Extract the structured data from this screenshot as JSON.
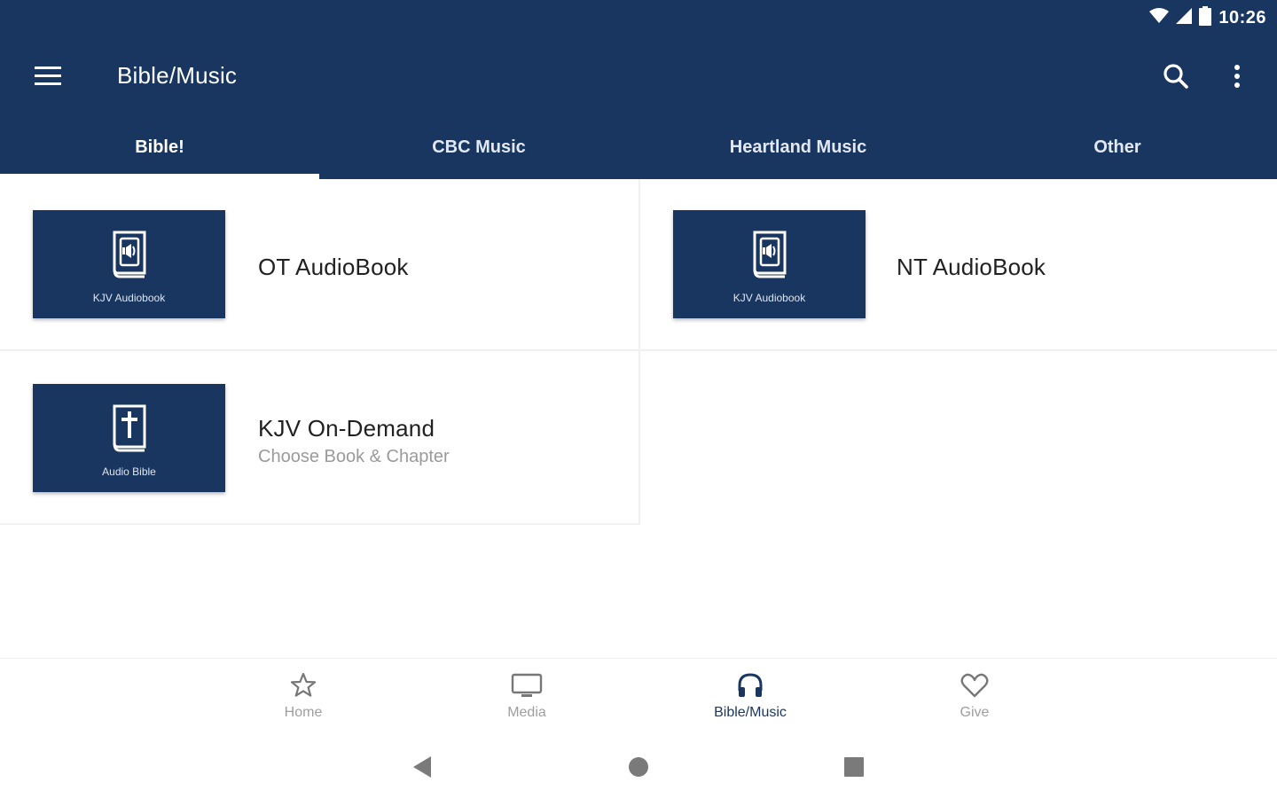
{
  "status_bar": {
    "time": "10:26"
  },
  "toolbar": {
    "title": "Bible/Music"
  },
  "tabs": [
    {
      "label": "Bible!",
      "active": true
    },
    {
      "label": "CBC Music",
      "active": false
    },
    {
      "label": "Heartland Music",
      "active": false
    },
    {
      "label": "Other",
      "active": false
    }
  ],
  "cards": [
    {
      "title": "OT AudioBook",
      "thumb_caption": "KJV Audiobook",
      "icon": "audio-book-icon"
    },
    {
      "title": "NT AudioBook",
      "thumb_caption": "KJV Audiobook",
      "icon": "audio-book-icon"
    },
    {
      "title": "KJV On-Demand",
      "subtitle": "Choose Book & Chapter",
      "thumb_caption": "Audio Bible",
      "icon": "bible-cross-icon"
    }
  ],
  "bottom_nav": [
    {
      "label": "Home",
      "icon": "star-icon",
      "active": false
    },
    {
      "label": "Media",
      "icon": "monitor-icon",
      "active": false
    },
    {
      "label": "Bible/Music",
      "icon": "headphones-icon",
      "active": true
    },
    {
      "label": "Give",
      "icon": "heart-icon",
      "active": false
    }
  ],
  "colors": {
    "primary": "#18365f",
    "background": "#ffffff",
    "inactive_nav": "#9e9e9e",
    "subtitle": "#9a9a9a"
  }
}
